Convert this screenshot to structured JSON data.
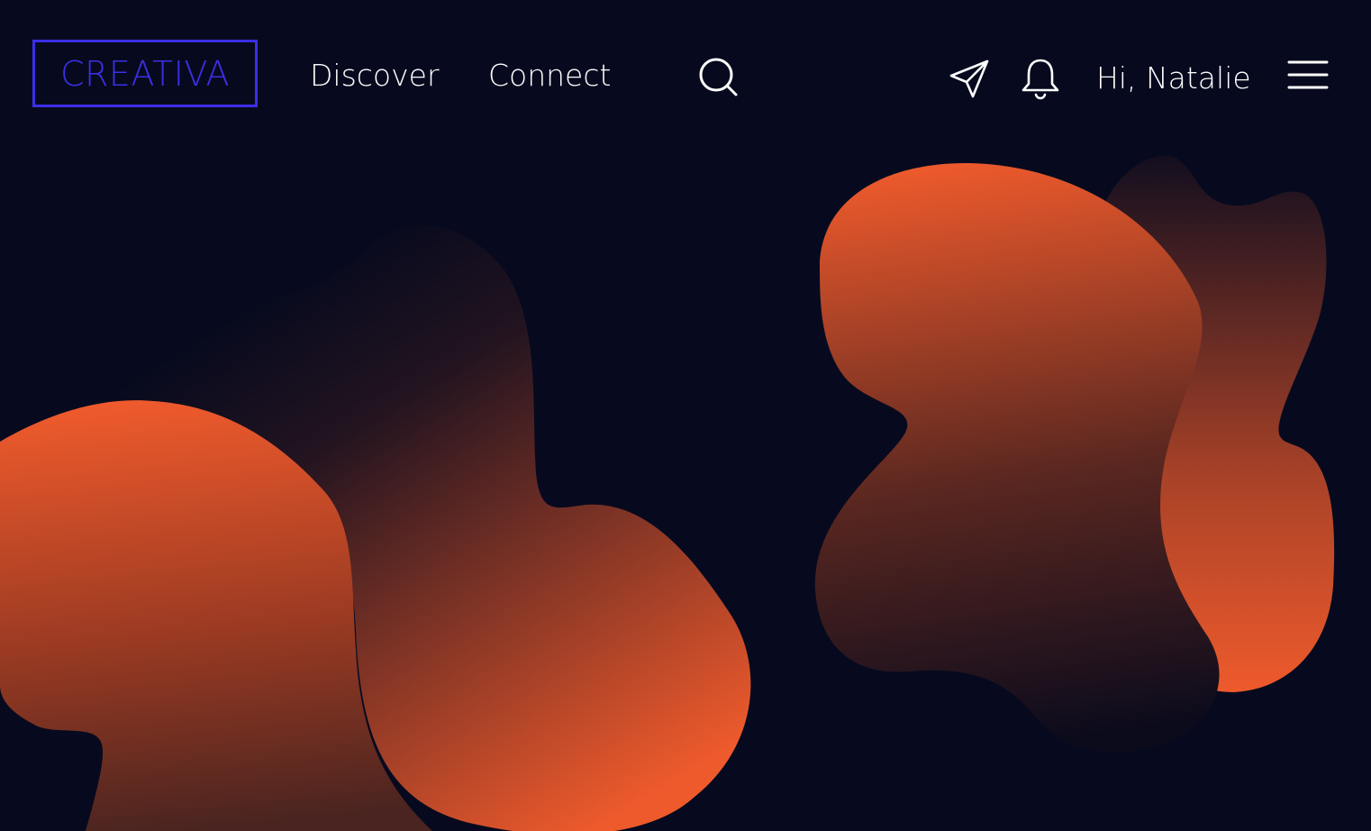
{
  "header": {
    "logo_text": "CREATIVA",
    "nav": [
      {
        "label": "Discover"
      },
      {
        "label": "Connect"
      }
    ],
    "icons": {
      "search": "search-icon",
      "send": "send-icon",
      "bell": "bell-icon",
      "menu": "hamburger-menu-icon"
    },
    "greeting": "Hi, Natalie"
  },
  "colors": {
    "background": "#070a1e",
    "logo_accent": "#3b2fe6",
    "blob_orange": "#ee5a2c",
    "text": "#ffffff"
  }
}
